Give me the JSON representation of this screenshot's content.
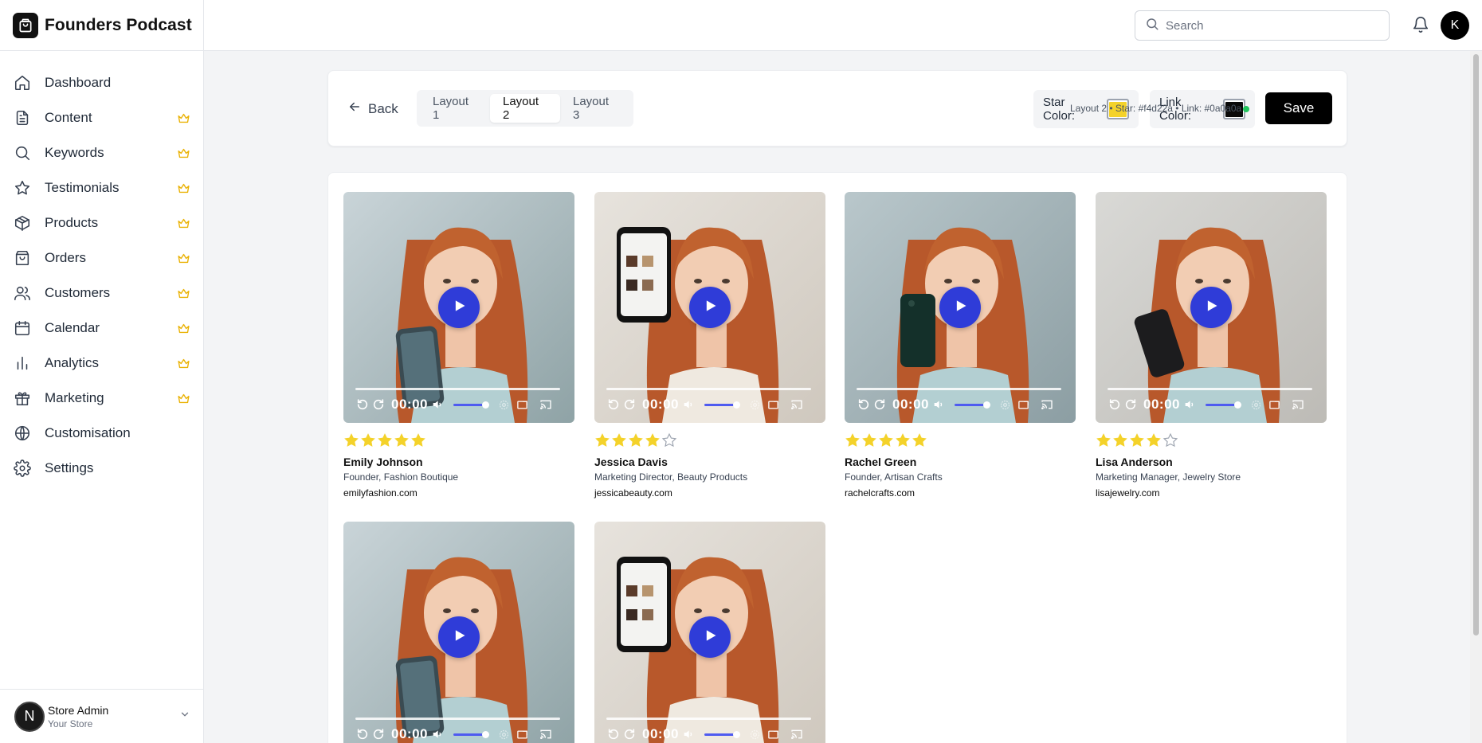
{
  "brand": {
    "title": "Founders Podcast"
  },
  "sidebar": {
    "items": [
      {
        "label": "Dashboard",
        "icon": "home-icon",
        "premium": false
      },
      {
        "label": "Content",
        "icon": "document-icon",
        "premium": true
      },
      {
        "label": "Keywords",
        "icon": "search-icon",
        "premium": true
      },
      {
        "label": "Testimonials",
        "icon": "star-icon",
        "premium": true
      },
      {
        "label": "Products",
        "icon": "package-icon",
        "premium": true
      },
      {
        "label": "Orders",
        "icon": "shopping-bag-icon",
        "premium": true
      },
      {
        "label": "Customers",
        "icon": "users-icon",
        "premium": true
      },
      {
        "label": "Calendar",
        "icon": "calendar-icon",
        "premium": true
      },
      {
        "label": "Analytics",
        "icon": "bar-chart-icon",
        "premium": true
      },
      {
        "label": "Marketing",
        "icon": "gift-icon",
        "premium": true
      },
      {
        "label": "Customisation",
        "icon": "globe-icon",
        "premium": false
      },
      {
        "label": "Settings",
        "icon": "gear-icon",
        "premium": false
      }
    ],
    "user": {
      "initial": "N",
      "name": "Store Admin",
      "store": "Your Store"
    }
  },
  "header": {
    "search_placeholder": "Search",
    "avatar_initial": "K"
  },
  "toolbar": {
    "back_label": "Back",
    "tabs": [
      {
        "label": "Layout 1",
        "active": false
      },
      {
        "label": "Layout 2",
        "active": true
      },
      {
        "label": "Layout 3",
        "active": false
      }
    ],
    "star_color_label": "Star Color:",
    "star_color": "#f4d22a",
    "link_color_label": "Link Color:",
    "link_color": "#0a0a0a",
    "status": "Layout 2 • Star: #f4d22a • Link: #0a0a0a",
    "save_label": "Save"
  },
  "testimonials": [
    {
      "name": "Emily Johnson",
      "role": "Founder, Fashion Boutique",
      "site": "emilyfashion.com",
      "rating": 5,
      "time": "00:00"
    },
    {
      "name": "Jessica Davis",
      "role": "Marketing Director, Beauty Products",
      "site": "jessicabeauty.com",
      "rating": 4,
      "time": "00:00"
    },
    {
      "name": "Rachel Green",
      "role": "Founder, Artisan Crafts",
      "site": "rachelcrafts.com",
      "rating": 5,
      "time": "00:00"
    },
    {
      "name": "Lisa Anderson",
      "role": "Marketing Manager, Jewelry Store",
      "site": "lisajewelry.com",
      "rating": 4,
      "time": "00:00"
    },
    {
      "name": "",
      "role": "",
      "site": "",
      "rating": 0,
      "time": "00:00"
    },
    {
      "name": "",
      "role": "",
      "site": "",
      "rating": 0,
      "time": "00:00"
    }
  ]
}
